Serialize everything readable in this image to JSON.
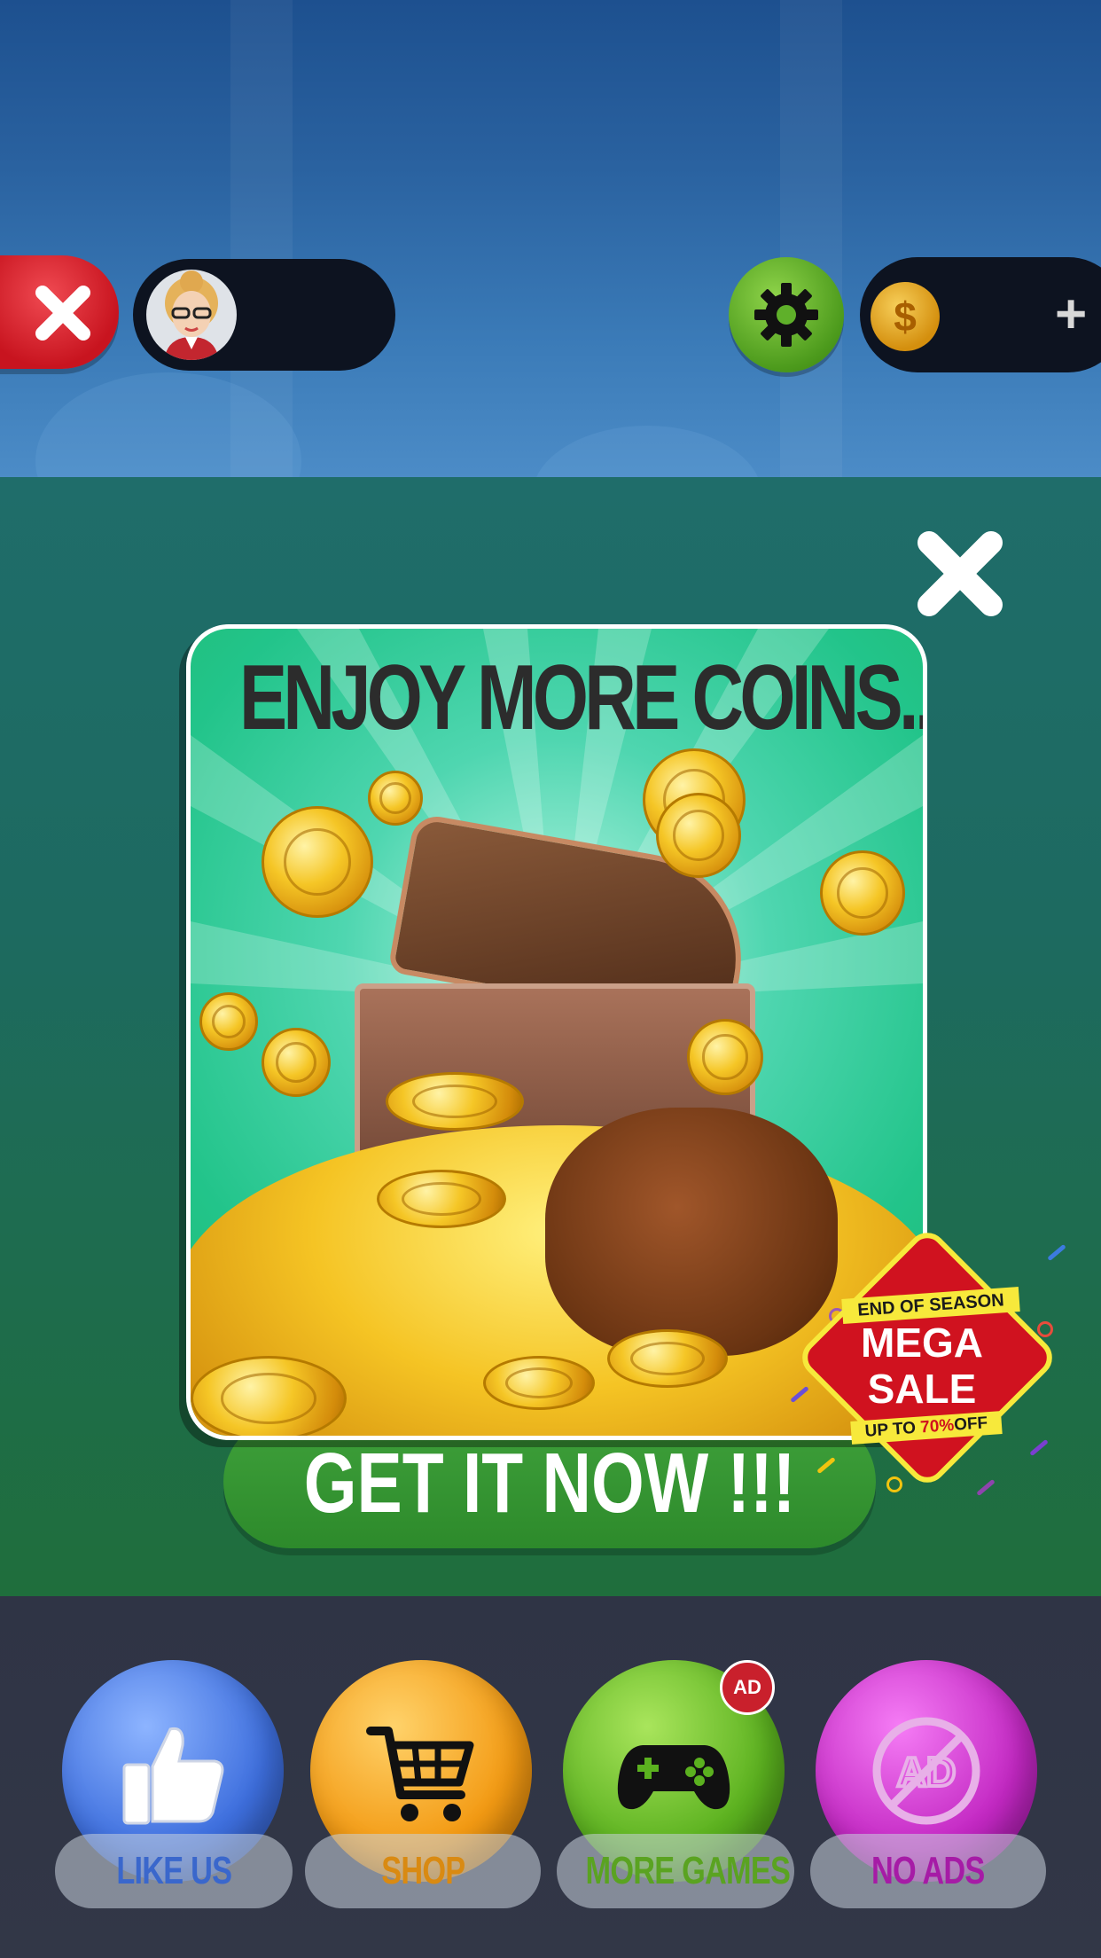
{
  "top_bar": {
    "close_icon": "close-x-icon",
    "avatar_icon": "woman-avatar-icon",
    "settings_icon": "gear-icon",
    "coin_icon": "dollar-coin-icon",
    "coin_symbol": "$",
    "add_icon": "plus-icon",
    "add_symbol": "+"
  },
  "popup": {
    "close_icon": "close-x-icon",
    "title": "ENJOY MORE COINS...",
    "image_icon": "treasure-chest-coins-icon",
    "cta_label": "GET IT NOW !!!",
    "badge": {
      "top_line": "END OF SEASON",
      "line1": "MEGA",
      "line2": "SALE",
      "bottom_prefix": "UP TO",
      "bottom_highlight": "70%",
      "bottom_suffix": "OFF"
    }
  },
  "bottom_bar": {
    "items": [
      {
        "label": "LIKE US",
        "icon": "thumbs-up-icon"
      },
      {
        "label": "SHOP",
        "icon": "shopping-cart-icon"
      },
      {
        "label": "MORE GAMES",
        "icon": "gamepad-icon",
        "badge": "AD"
      },
      {
        "label": "NO ADS",
        "icon": "no-ads-icon"
      }
    ]
  },
  "colors": {
    "close_red": "#c8141f",
    "settings_green": "#4c9a1c",
    "cta_green": "#2d8a2b",
    "like_blue": "#3e6fde",
    "shop_orange": "#f39a13",
    "games_green": "#5bb11f",
    "noads_magenta": "#c328c3"
  }
}
